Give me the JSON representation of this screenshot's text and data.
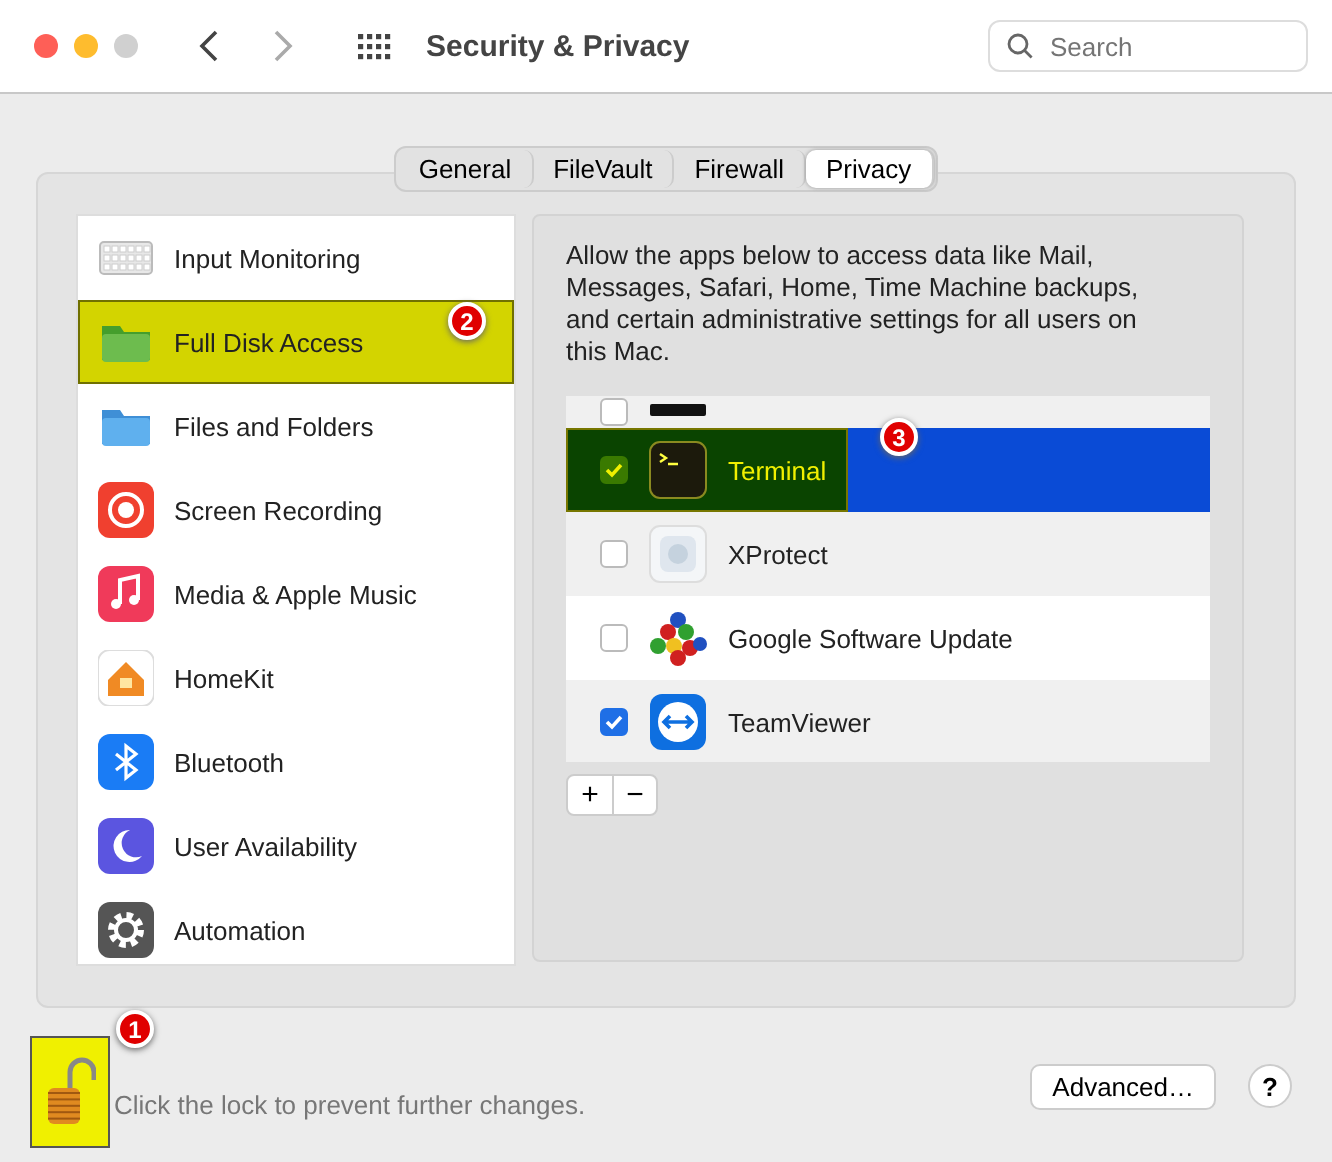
{
  "window": {
    "title": "Security & Privacy"
  },
  "search": {
    "placeholder": "Search"
  },
  "tabs": [
    {
      "label": "General",
      "selected": false
    },
    {
      "label": "FileVault",
      "selected": false
    },
    {
      "label": "Firewall",
      "selected": false
    },
    {
      "label": "Privacy",
      "selected": true
    }
  ],
  "sidebar": {
    "items": [
      {
        "label": "Input Monitoring",
        "kind": "keyboard",
        "highlighted": false
      },
      {
        "label": "Full Disk Access",
        "kind": "folder",
        "highlighted": true,
        "badge": "2"
      },
      {
        "label": "Files and Folders",
        "kind": "folder",
        "highlighted": false
      },
      {
        "label": "Screen Recording",
        "kind": "record",
        "highlighted": false
      },
      {
        "label": "Media & Apple Music",
        "kind": "music",
        "highlighted": false
      },
      {
        "label": "HomeKit",
        "kind": "home",
        "highlighted": false
      },
      {
        "label": "Bluetooth",
        "kind": "bluetooth",
        "highlighted": false
      },
      {
        "label": "User Availability",
        "kind": "moon",
        "highlighted": false
      },
      {
        "label": "Automation",
        "kind": "gear",
        "highlighted": false
      }
    ]
  },
  "description": "Allow the apps below to access data like Mail, Messages, Safari, Home, Time Machine backups, and certain administrative settings for all users on this Mac.",
  "apps": [
    {
      "kind": "dark",
      "checked": false,
      "selected": false,
      "highlighted": false,
      "cut": true
    },
    {
      "name": "Terminal",
      "kind": "terminal",
      "checked": true,
      "selected": true,
      "highlighted": true,
      "badge": "3"
    },
    {
      "name": "XProtect",
      "kind": "shield",
      "checked": false,
      "selected": false,
      "highlighted": false
    },
    {
      "name": "Google Software Update",
      "kind": "balls",
      "checked": false,
      "selected": false,
      "highlighted": false
    },
    {
      "name": "TeamViewer",
      "kind": "arrows",
      "checked": true,
      "selected": false,
      "highlighted": false
    }
  ],
  "list_buttons": [
    "+",
    "−"
  ],
  "lock": {
    "locked": false,
    "highlighted": true,
    "badge": "1",
    "text": "Click the lock to prevent further changes."
  },
  "advanced_button": "Advanced…",
  "help_button": "?"
}
